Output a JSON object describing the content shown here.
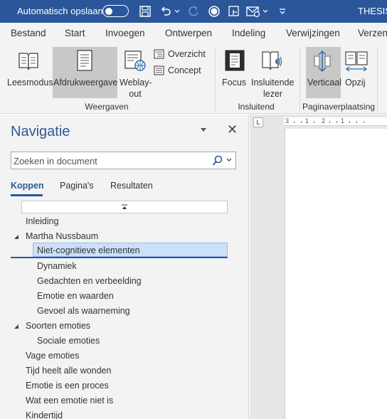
{
  "titlebar": {
    "autosave_label": "Automatisch opslaan",
    "doc_title": "THESIS...",
    "icons": [
      "save-icon",
      "undo-icon",
      "redo-icon",
      "circle-icon",
      "touch-mode-icon",
      "mail-icon",
      "customize-icon"
    ]
  },
  "tabs": [
    "Bestand",
    "Start",
    "Invoegen",
    "Ontwerpen",
    "Indeling",
    "Verwijzingen",
    "Verzen"
  ],
  "ribbon": {
    "views": {
      "leesmodus": "Leesmodus",
      "afdrukweergave": "Afdrukweergave",
      "weblay_line1": "Weblay-",
      "weblay_line2": "out",
      "overzicht": "Overzicht",
      "concept": "Concept",
      "group_label": "Weergaven"
    },
    "immersive": {
      "focus": "Focus",
      "insluitende_line1": "Insluitende",
      "insluitende_line2": "lezer",
      "group_label": "Insluitend"
    },
    "page_movement": {
      "verticaal": "Verticaal",
      "opzij": "Opzij",
      "group_label": "Paginaverplaatsing"
    }
  },
  "navigation": {
    "title": "Navigatie",
    "search_placeholder": "Zoeken in document",
    "tabs": {
      "koppen": "Koppen",
      "paginas": "Pagina's",
      "resultaten": "Resultaten"
    },
    "headings": [
      {
        "label": "Inleiding"
      },
      {
        "label": "Martha Nussbaum"
      },
      {
        "label": "Niet-cognitieve elementen"
      },
      {
        "label": "Dynamiek"
      },
      {
        "label": "Gedachten en verbeelding"
      },
      {
        "label": "Emotie en waarden"
      },
      {
        "label": "Gevoel als waarneming"
      },
      {
        "label": "Soorten emoties"
      },
      {
        "label": "Sociale emoties"
      },
      {
        "label": "Vage emoties"
      },
      {
        "label": "Tijd heelt alle wonden"
      },
      {
        "label": "Emotie is een proces"
      },
      {
        "label": "Wat een emotie niet is"
      },
      {
        "label": "Kindertijd"
      }
    ]
  },
  "ruler": {
    "tab_marker": "L",
    "labels": [
      "3",
      "1",
      "2",
      "1"
    ]
  },
  "colors": {
    "accent": "#2b579a",
    "selected_heading_bg": "#cce0f7"
  }
}
